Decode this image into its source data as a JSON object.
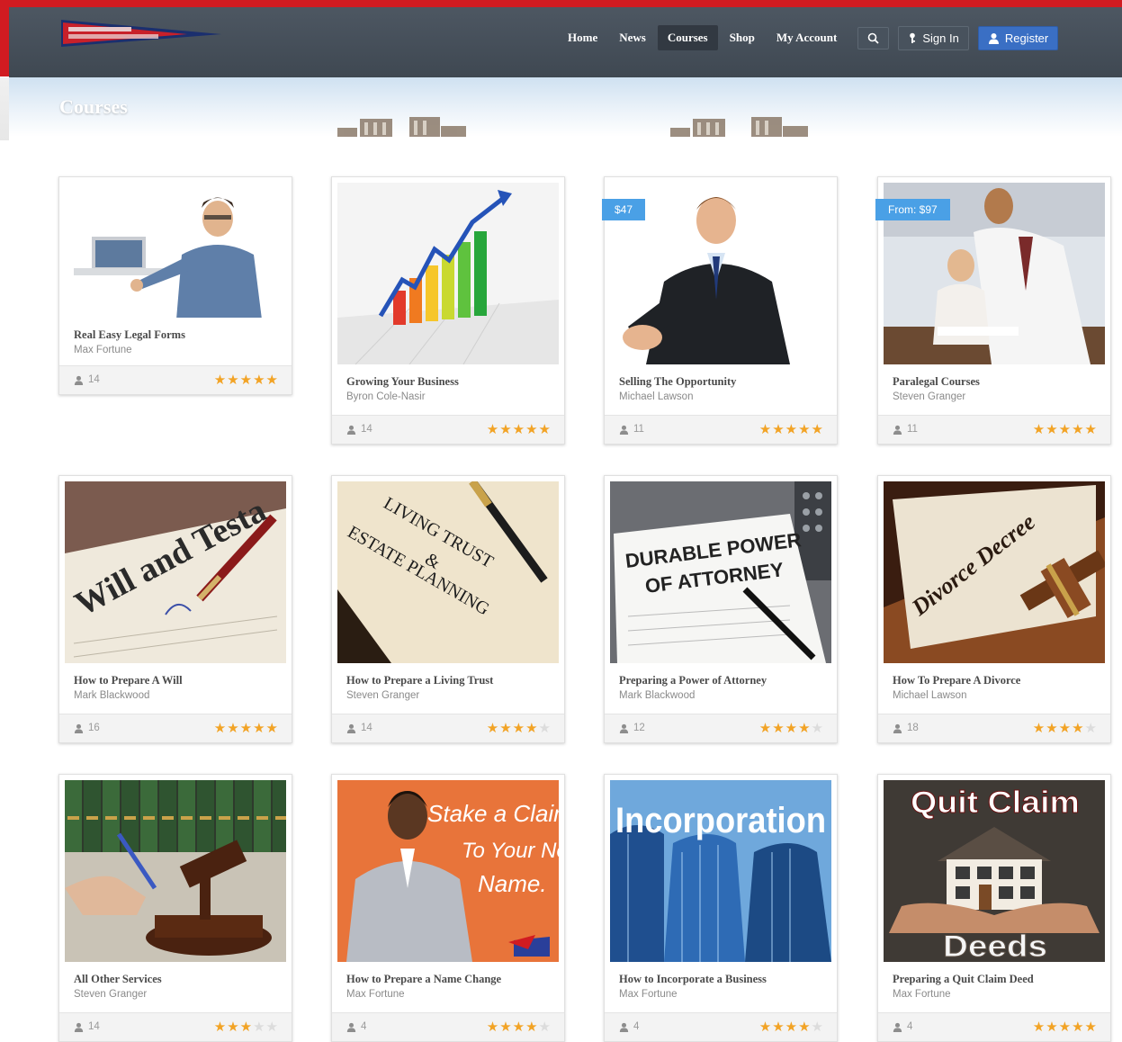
{
  "header": {
    "nav": [
      "Home",
      "News",
      "Courses",
      "Shop",
      "My Account"
    ],
    "active_nav": "Courses",
    "sign_in": "Sign In",
    "register": "Register",
    "search_icon": "search-icon",
    "colors": {
      "brand_red": "#d11b21",
      "navbar": "#444d57",
      "accent_blue": "#3a6fc4",
      "star": "#f2a325"
    }
  },
  "page": {
    "title": "Courses"
  },
  "courses": [
    {
      "title": "Real Easy Legal Forms",
      "author": "Max Fortune",
      "students": "14",
      "rating": 5,
      "price": "",
      "image": "man-with-laptop"
    },
    {
      "title": "Growing Your Business",
      "author": "Byron Cole-Nasir",
      "students": "14",
      "rating": 5,
      "price": "",
      "image": "growth-chart"
    },
    {
      "title": "Selling The Opportunity",
      "author": "Michael Lawson",
      "students": "11",
      "rating": 5,
      "price": "$47",
      "image": "handshake-man"
    },
    {
      "title": "Paralegal Courses",
      "author": "Steven Granger",
      "students": "11",
      "rating": 5,
      "price": "From: $97",
      "image": "office-meeting"
    },
    {
      "title": "How to Prepare A Will",
      "author": "Mark Blackwood",
      "students": "16",
      "rating": 5,
      "price": "",
      "image": "last-will-document"
    },
    {
      "title": "How to Prepare a Living Trust",
      "author": "Steven Granger",
      "students": "14",
      "rating": 4,
      "price": "",
      "image": "living-trust-document"
    },
    {
      "title": "Preparing a Power of Attorney",
      "author": "Mark Blackwood",
      "students": "12",
      "rating": 4,
      "price": "",
      "image": "power-of-attorney-document"
    },
    {
      "title": "How To Prepare A Divorce",
      "author": "Michael Lawson",
      "students": "18",
      "rating": 4,
      "price": "",
      "image": "divorce-decree-gavel"
    },
    {
      "title": "All Other Services",
      "author": "Steven Granger",
      "students": "14",
      "rating": 3,
      "price": "",
      "image": "gavel-law-books"
    },
    {
      "title": "How to Prepare a Name Change",
      "author": "Max Fortune",
      "students": "4",
      "rating": 4,
      "price": "",
      "image": "name-change-woman"
    },
    {
      "title": "How to Incorporate a Business",
      "author": "Max Fortune",
      "students": "4",
      "rating": 4,
      "price": "",
      "image": "incorporation-skyscrapers"
    },
    {
      "title": "Preparing a Quit Claim Deed",
      "author": "Max Fortune",
      "students": "4",
      "rating": 5,
      "price": "",
      "image": "quit-claim-house"
    }
  ],
  "image_text": {
    "will": "Will and Testa",
    "trust_1": "LIVING TRUST",
    "trust_2": "&",
    "trust_3": "ESTATE PLANNING",
    "poa_1": "DURABLE POWER",
    "poa_2": "OF ATTORNEY",
    "divorce": "Divorce Decree",
    "name_1": "Stake a Claim",
    "name_2": "To Your New",
    "name_3": "Name.",
    "incorp": "Incorporation",
    "quit": "Quit Claim",
    "deeds": "Deeds"
  }
}
